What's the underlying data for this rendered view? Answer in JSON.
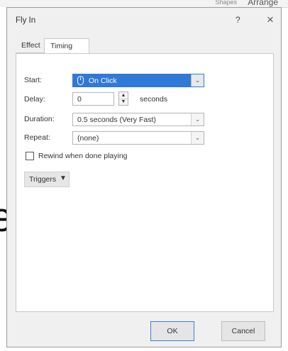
{
  "background": {
    "ribbon_text": "Arrange",
    "ribbon_small_text": "Shapes",
    "canvas_glyph": "e"
  },
  "dialog": {
    "title": "Fly In",
    "help_label": "?",
    "close_label": "×"
  },
  "tabs": [
    {
      "label": "Effect",
      "active": false
    },
    {
      "label": "Timing",
      "active": true
    }
  ],
  "timing": {
    "start": {
      "label": "Start:",
      "value": "On Click",
      "icon": "mouse-icon"
    },
    "delay": {
      "label": "Delay:",
      "value": "0",
      "unit": "seconds"
    },
    "duration": {
      "label": "Duration:",
      "value": "0.5 seconds (Very Fast)"
    },
    "repeat": {
      "label": "Repeat:",
      "value": "(none)"
    },
    "rewind": {
      "label": "Rewind when done playing",
      "checked": false
    }
  },
  "triggers": {
    "label": "Triggers",
    "icon": "double-chevron-down-icon"
  },
  "footer": {
    "ok_label": "OK",
    "cancel_label": "Cancel"
  },
  "colors": {
    "selection": "#3079d8",
    "dialog_bg": "#f0f0f0"
  }
}
